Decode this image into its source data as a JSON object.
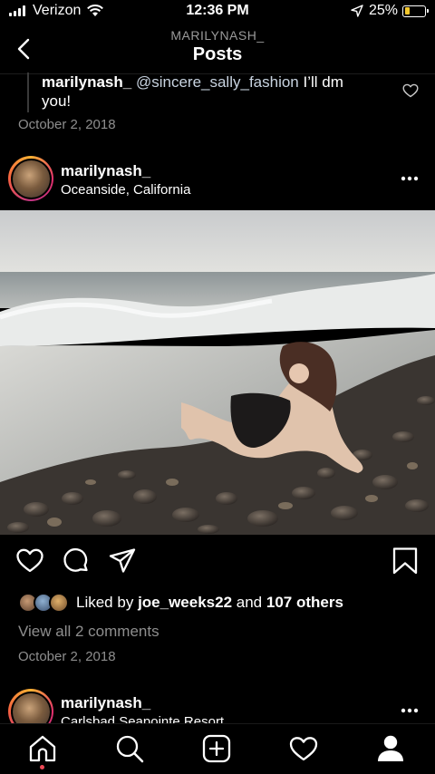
{
  "status_bar": {
    "carrier": "Verizon",
    "time": "12:36 PM",
    "battery": "25%",
    "battery_level": 0.25,
    "battery_color": "#f5c82c",
    "icons": [
      "signal-icon",
      "wifi-icon",
      "location-arrow-icon",
      "battery-icon"
    ]
  },
  "header": {
    "subtitle": "MARILYNASH_",
    "title": "Posts",
    "back_icon": "chevron-left-icon"
  },
  "previous_comment": {
    "username": "marilynash_",
    "mention": "@sincere_sally_fashion",
    "text_line1_rest": " I’ll dm",
    "text_line2": "you!",
    "date": "October 2, 2018"
  },
  "post": {
    "username": "marilynash_",
    "location": "Oceanside, California",
    "likes_prefix": "Liked by",
    "liked_by_user": "joe_weeks22",
    "likes_and": "and",
    "likes_others": "107 others",
    "view_comments": "View all 2 comments",
    "date": "October 2, 2018",
    "action_icons": [
      "heart-icon",
      "comment-icon",
      "share-icon",
      "bookmark-icon"
    ]
  },
  "next_post": {
    "username": "marilynash_",
    "location": "Carlsbad Seapointe Resort"
  },
  "tab_bar": {
    "icons": [
      "home-icon",
      "search-icon",
      "new-post-icon",
      "activity-heart-icon",
      "profile-icon"
    ],
    "notification_color": "#ed4956"
  }
}
